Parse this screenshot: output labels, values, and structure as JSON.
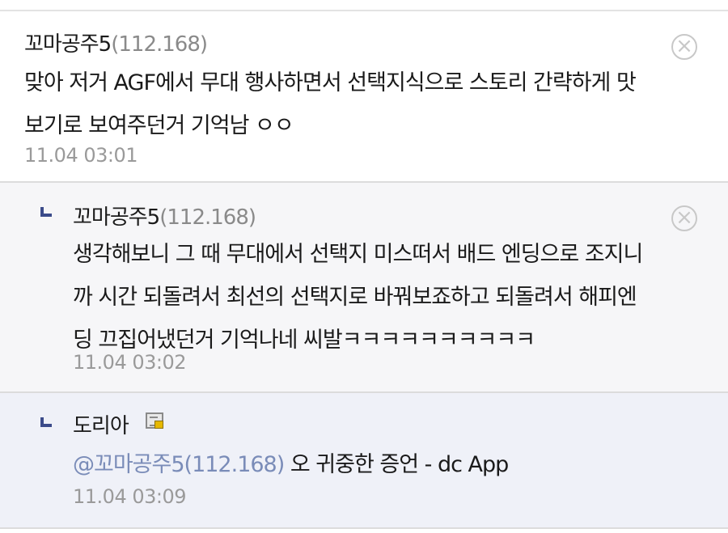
{
  "comments": [
    {
      "author": "꼬마공주5",
      "ip": "(112.168)",
      "text_line1": "맞아 저거 AGF에서 무대 행사하면서 선택지식으로 스토리 간략하게 맛",
      "text_line2": "보기로 보여주던거 기억남 ㅇㅇ",
      "date": "11.04 03:01",
      "delete_icon": "circle-x"
    },
    {
      "author": "꼬마공주5",
      "ip": "(112.168)",
      "text_line1": "생각해보니 그 때 무대에서 선택지 미스떠서 배드 엔딩으로 조지니",
      "text_line2": "까 시간 되돌려서 최선의 선택지로 바꿔보죠하고 되돌려서 해피엔",
      "text_line3": "딩 끄집어냈던거 기억나네 씨발ㅋㅋㅋㅋㅋㅋㅋㅋㅋㅋ",
      "date": "11.04 03:02",
      "delete_icon": "circle-x",
      "reply_icon": "reply-arrow"
    },
    {
      "author": "도리아",
      "mention": "@꼬마공주5(112.168)",
      "text": " 오 귀중한 증언 - dc App",
      "date": "11.04 03:09",
      "reply_icon": "reply-arrow",
      "badge_icon": "fixed-nick-icon"
    }
  ]
}
